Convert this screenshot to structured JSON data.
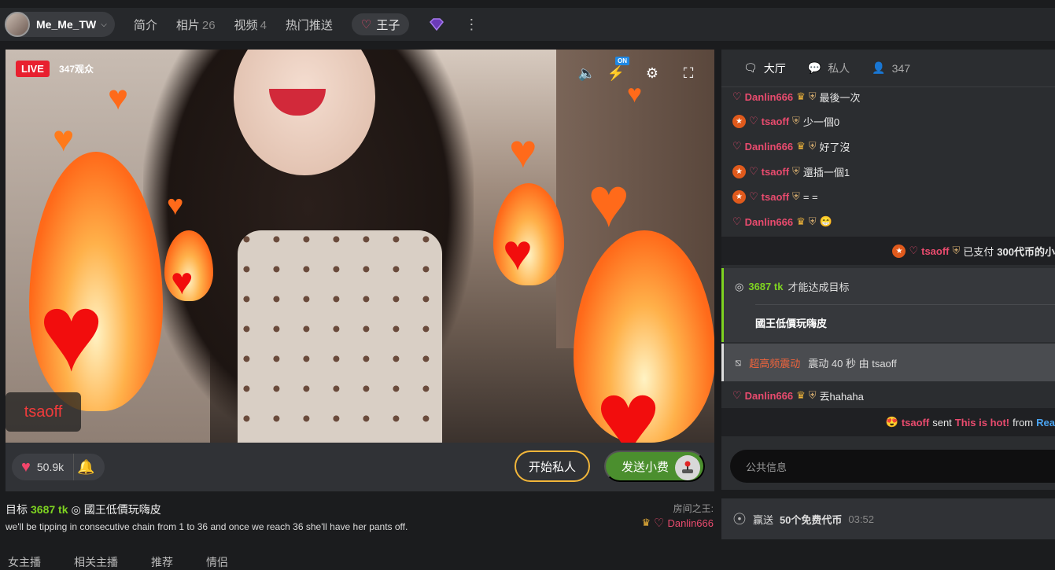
{
  "header": {
    "username": "Me_Me_TW",
    "nav": [
      {
        "label": "简介",
        "count": ""
      },
      {
        "label": "相片",
        "count": "26"
      },
      {
        "label": "视频",
        "count": "4"
      },
      {
        "label": "热门推送",
        "count": ""
      }
    ],
    "prince_label": "王子"
  },
  "video": {
    "live_label": "LIVE",
    "viewers": "347观众",
    "on_badge": "ON",
    "name_tag": "tsaoff"
  },
  "video_bar": {
    "likes": "50.9k",
    "private_label": "开始私人",
    "tip_label": "发送小费"
  },
  "goal": {
    "prefix": "目标",
    "amount": "3687 tk",
    "title": "國王低價玩嗨皮",
    "description": "we'll be tipping in consecutive chain from 1 to 36 and once we reach 36 she'll have her pants off."
  },
  "king": {
    "label": "房间之王:",
    "name": "Danlin666"
  },
  "bottom_tabs": [
    "女主播",
    "相关主播",
    "推荐",
    "情侣"
  ],
  "chat": {
    "tabs": [
      {
        "label": "大厅",
        "icon": "chat-bubble-icon"
      },
      {
        "label": "私人",
        "icon": "private-chat-icon"
      },
      {
        "label": "347",
        "icon": "user-icon"
      }
    ],
    "messages": [
      {
        "user": "Danlin666",
        "type": "danlin",
        "text": "最後一次"
      },
      {
        "user": "tsaoff",
        "type": "tsaoff",
        "text": "少一個0"
      },
      {
        "user": "Danlin666",
        "type": "danlin",
        "text": "好了沒"
      },
      {
        "user": "tsaoff",
        "type": "tsaoff",
        "text": "還插一個1"
      },
      {
        "user": "tsaoff",
        "type": "tsaoff",
        "text": "= ="
      },
      {
        "user": "Danlin666",
        "type": "danlin",
        "text": "😁"
      }
    ],
    "paid": {
      "user": "tsaoff",
      "text_pre": "已支付",
      "amount": "300代币的小"
    },
    "goal_notice": {
      "amount": "3687 tk",
      "text": "才能达成目标",
      "title": "國王低價玩嗨皮"
    },
    "vibe_notice": {
      "level": "超高频震动",
      "text": "震动 40 秒 由 tsaoff"
    },
    "last_message": {
      "user": "Danlin666",
      "text": "丟hahaha"
    },
    "gift_notice": {
      "user": "tsaoff",
      "sent": "sent",
      "gift": "This is hot!",
      "from": "from",
      "source": "Rea"
    },
    "input_placeholder": "公共信息",
    "free_tokens": {
      "pre": "赢送",
      "amount": "50个免费代币",
      "suffix": "03:52"
    }
  },
  "colors": {
    "accent_pink": "#e94b6e",
    "green": "#7ed321",
    "gold": "#f2b63a",
    "live_red": "#e8202f"
  }
}
